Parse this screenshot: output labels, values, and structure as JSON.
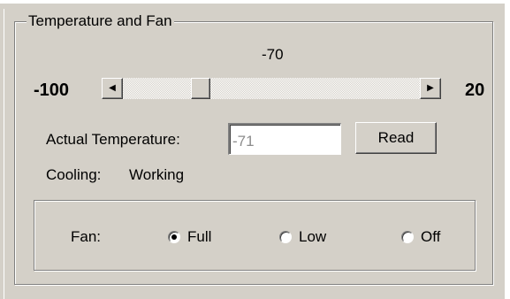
{
  "group": {
    "title": "Temperature and Fan"
  },
  "slider": {
    "value": "-70",
    "min_label": "-100",
    "max_label": "20",
    "position_value": -70,
    "left_arrow": "◀",
    "right_arrow": "▶"
  },
  "temperature": {
    "label": "Actual Temperature:",
    "value": "-71",
    "read_button": "Read"
  },
  "cooling": {
    "label": "Cooling:",
    "status": "Working"
  },
  "fan": {
    "label": "Fan:",
    "options": [
      {
        "label": "Full",
        "selected": true
      },
      {
        "label": "Low",
        "selected": false
      },
      {
        "label": "Off",
        "selected": false
      }
    ]
  }
}
